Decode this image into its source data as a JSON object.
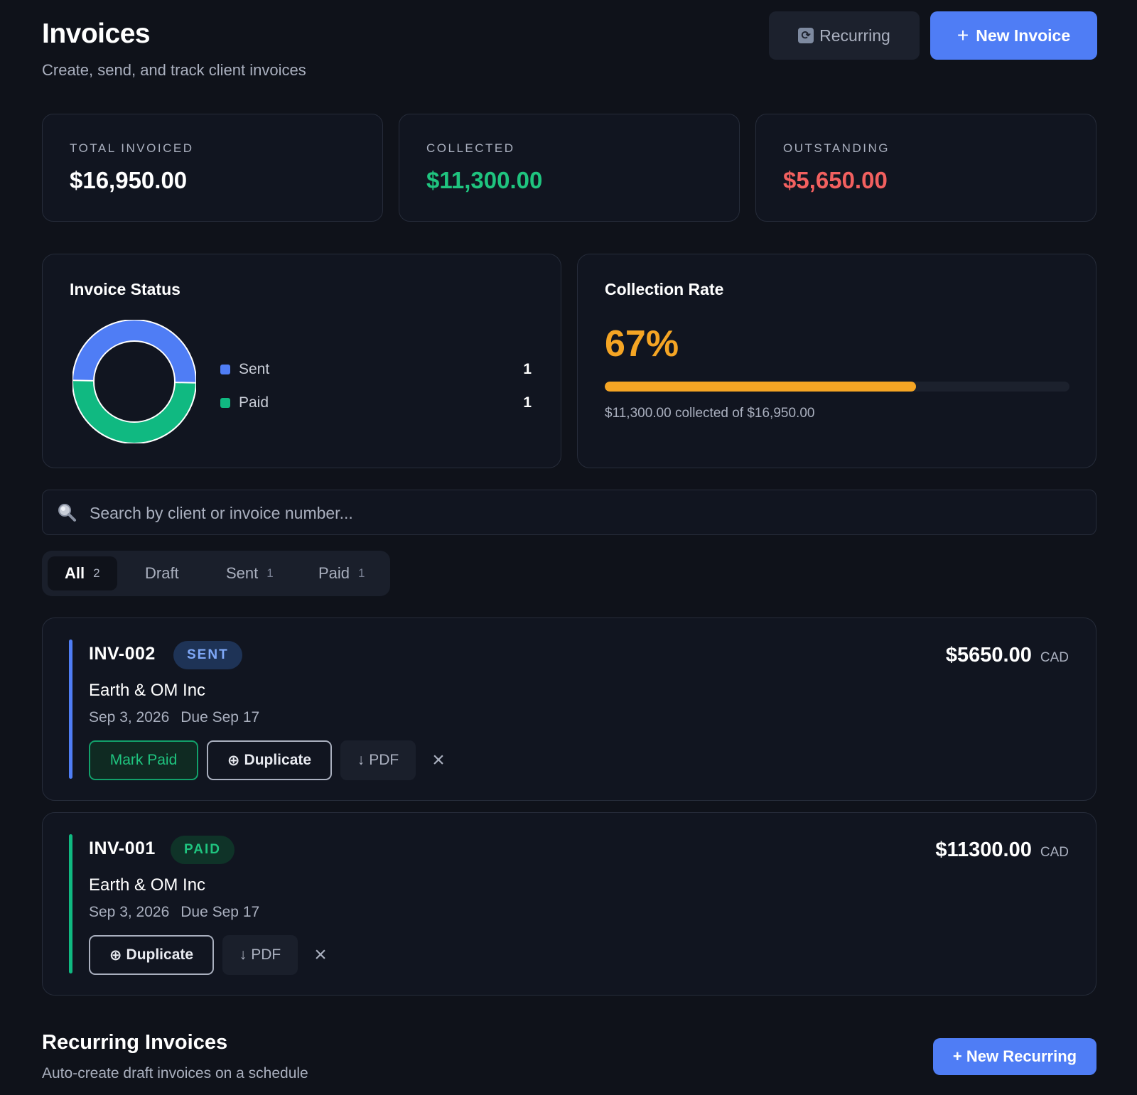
{
  "header": {
    "title": "Invoices",
    "subtitle": "Create, send, and track client invoices",
    "recurring_label": "Recurring",
    "new_invoice_label": "New Invoice"
  },
  "stats": [
    {
      "label": "TOTAL INVOICED",
      "value": "$16,950.00",
      "color": "#ffffff"
    },
    {
      "label": "COLLECTED",
      "value": "$11,300.00",
      "color": "#1fc47f"
    },
    {
      "label": "OUTSTANDING",
      "value": "$5,650.00",
      "color": "#f2605f"
    }
  ],
  "invoice_status": {
    "title": "Invoice Status",
    "legend": [
      {
        "name": "Sent",
        "count": "1",
        "color": "#4f7df5"
      },
      {
        "name": "Paid",
        "count": "1",
        "color": "#10b981"
      }
    ]
  },
  "chart_data": {
    "type": "pie",
    "title": "Invoice Status",
    "categories": [
      "Sent",
      "Paid"
    ],
    "values": [
      1,
      1
    ],
    "colors": [
      "#4f7df5",
      "#10b981"
    ],
    "donut": true,
    "legend": "right"
  },
  "collection_rate": {
    "title": "Collection Rate",
    "value": "67%",
    "fraction": 0.67,
    "caption": "$11,300.00 collected of $16,950.00",
    "color": "#f5a524"
  },
  "search": {
    "placeholder": "Search by client or invoice number..."
  },
  "tabs": [
    {
      "label": "All",
      "count": "2",
      "active": true
    },
    {
      "label": "Draft",
      "count": "",
      "active": false
    },
    {
      "label": "Sent",
      "count": "1",
      "active": false
    },
    {
      "label": "Paid",
      "count": "1",
      "active": false
    }
  ],
  "invoices": [
    {
      "number": "INV-002",
      "status": "SENT",
      "status_color": "#7fa8f7",
      "status_bg": "#1e3356",
      "accent_color": "#4f7df5",
      "client": "Earth & OM Inc",
      "date": "Sep 3, 2026",
      "due": "Due Sep 17",
      "amount": "$5650.00",
      "currency": "CAD",
      "mark_paid_label": "Mark Paid",
      "duplicate_label": "Duplicate",
      "pdf_label": "PDF"
    },
    {
      "number": "INV-001",
      "status": "PAID",
      "status_color": "#1fc47f",
      "status_bg": "#0f3328",
      "accent_color": "#10b981",
      "client": "Earth & OM Inc",
      "date": "Sep 3, 2026",
      "due": "Due Sep 17",
      "amount": "$11300.00",
      "currency": "CAD",
      "duplicate_label": "Duplicate",
      "pdf_label": "PDF"
    }
  ],
  "recurring": {
    "title": "Recurring Invoices",
    "subtitle": "Auto-create draft invoices on a schedule",
    "new_label": "+ New Recurring"
  }
}
